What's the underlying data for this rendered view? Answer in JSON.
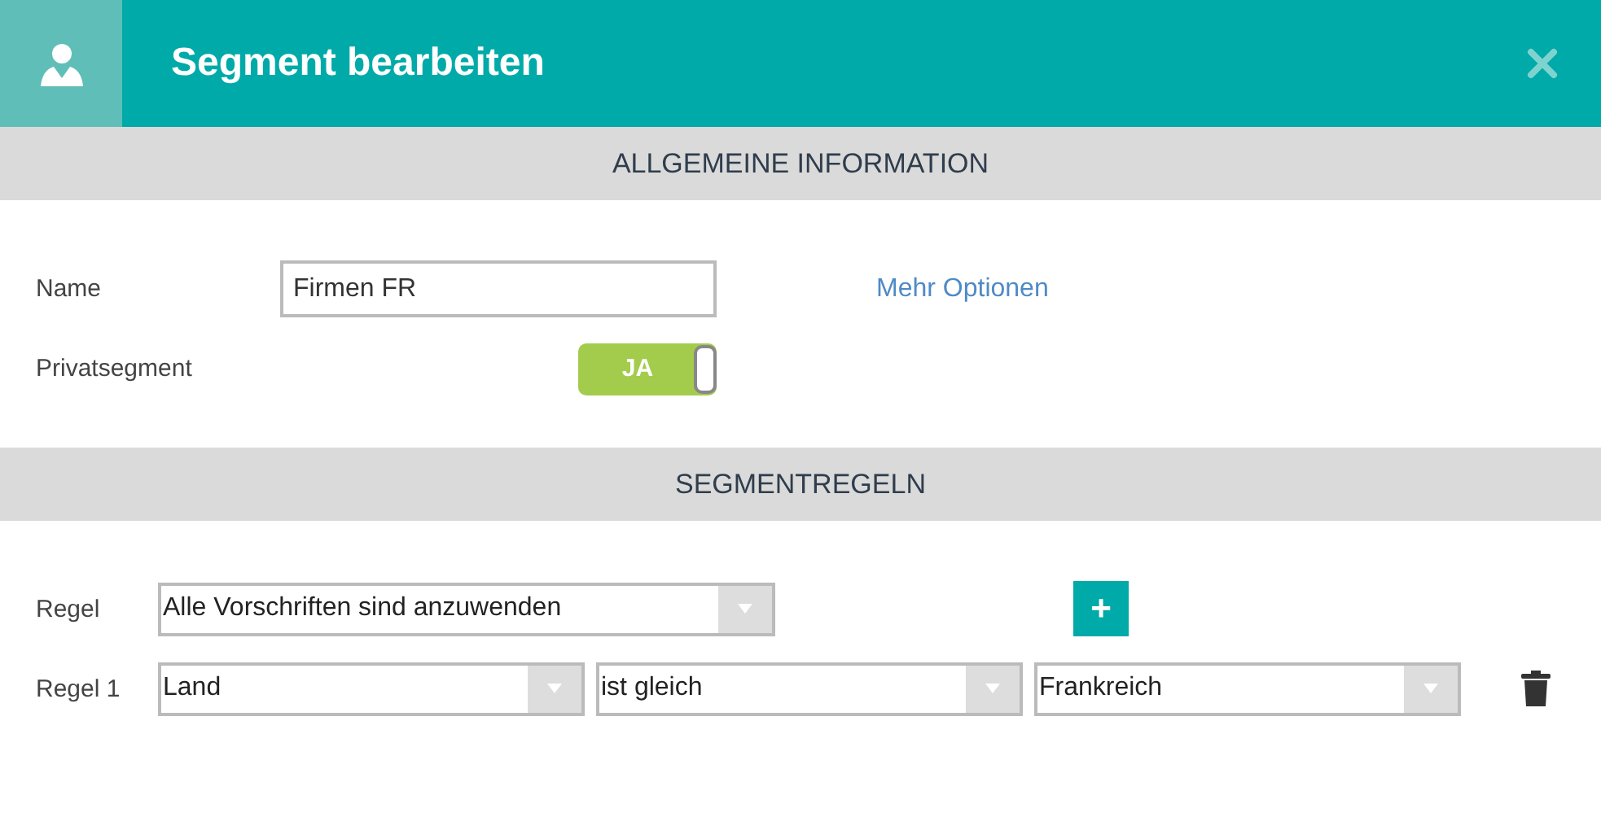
{
  "header": {
    "title": "Segment bearbeiten"
  },
  "sections": [
    {
      "title": "ALLGEMEINE INFORMATION"
    },
    {
      "title": "SEGMENTREGELN"
    }
  ],
  "general": {
    "name_label": "Name",
    "name_value": "Firmen FR",
    "more_link": "Mehr Optionen",
    "private_label": "Privatsegment",
    "private_toggle": {
      "on": true,
      "label": "JA"
    }
  },
  "rules": {
    "main": {
      "label": "Regel",
      "value": "Alle Vorschriften sind anzuwenden"
    },
    "add_button": "+",
    "items": [
      {
        "label": "Regel 1",
        "field": "Land",
        "operator": "ist gleich",
        "value": "Frankreich"
      }
    ]
  }
}
